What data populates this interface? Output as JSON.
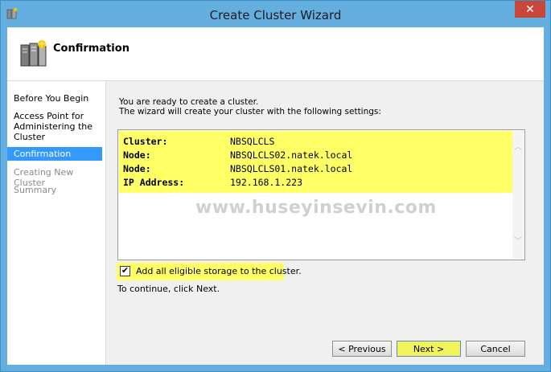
{
  "window": {
    "title": "Create Cluster Wizard",
    "close_label": "✕"
  },
  "header": {
    "title": "Confirmation"
  },
  "nav": {
    "items": [
      {
        "label": "Before You Begin",
        "state": "normal"
      },
      {
        "label": "Access Point for Administering the Cluster",
        "state": "normal"
      },
      {
        "label": "Confirmation",
        "state": "selected"
      },
      {
        "label": "Creating New Cluster",
        "state": "disabled"
      },
      {
        "label": "Summary",
        "state": "disabled"
      }
    ]
  },
  "content": {
    "intro_line1": "You are ready to create a cluster.",
    "intro_line2": "The wizard will create your cluster with the following settings:",
    "settings": [
      {
        "key": "Cluster:",
        "value": "NBSQLCLS"
      },
      {
        "key": "Node:",
        "value": "NBSQLCLS02.natek.local"
      },
      {
        "key": "Node:",
        "value": "NBSQLCLS01.natek.local"
      },
      {
        "key": "IP Address:",
        "value": "192.168.1.223"
      }
    ],
    "watermark": "www.huseyinsevin.com",
    "storage_checkbox": {
      "label": "Add all eligible storage to the cluster.",
      "checked": true
    },
    "continue_text": "To continue, click Next."
  },
  "buttons": {
    "previous": "< Previous",
    "next": "Next >",
    "cancel": "Cancel"
  },
  "colors": {
    "highlight": "#ffff66",
    "selected_nav": "#3399ff",
    "titlebar": "#65aee0",
    "close": "#c7483b"
  }
}
